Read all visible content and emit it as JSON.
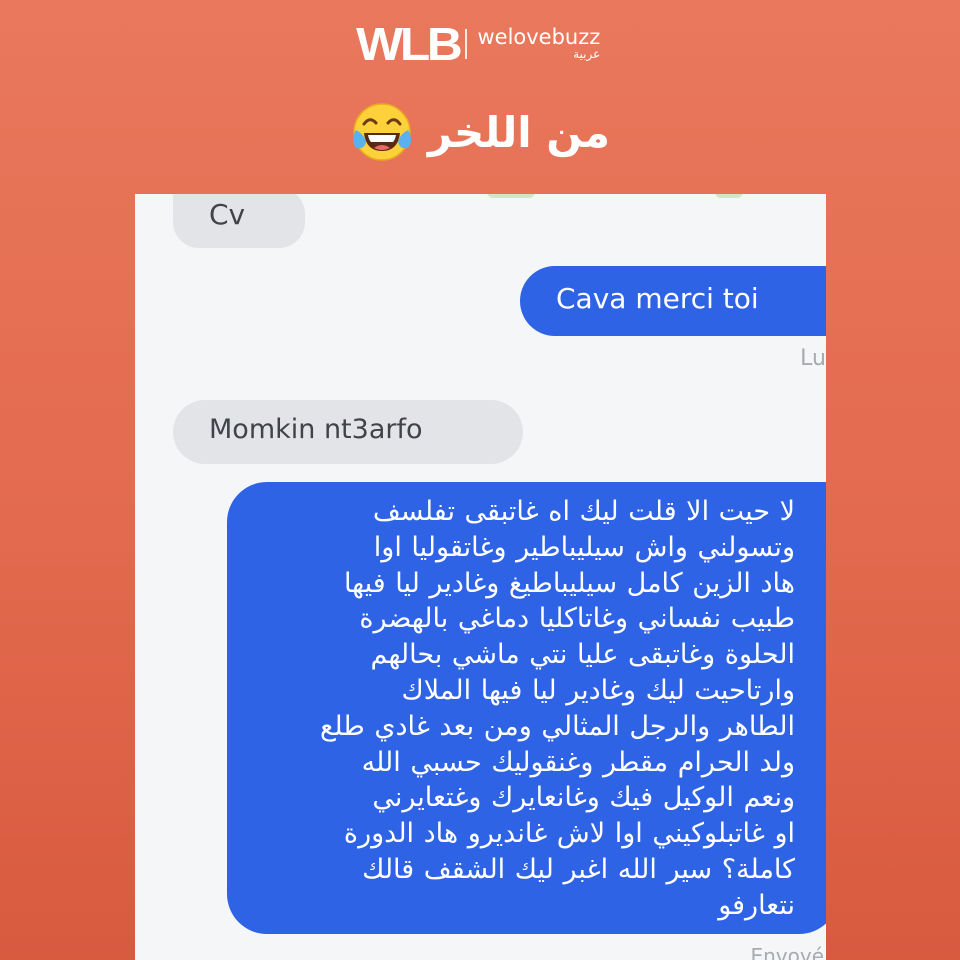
{
  "brand": {
    "logo": "WLB",
    "name": "welovebuzz",
    "sub": "عربية"
  },
  "headline": {
    "text": "من اللخر",
    "icon": "laughing-tears-emoji-icon"
  },
  "chat": {
    "messages": [
      {
        "side": "received",
        "text": "Cv"
      },
      {
        "side": "sent",
        "text": "Cava merci toi"
      },
      {
        "side": "received",
        "text": "Momkin nt3arfo"
      },
      {
        "side": "sent",
        "lines": [
          "لا حيت الا قلت ليك اه غاتبقى تفلسف",
          "وتسولني واش سيليباطير وغاتقوليا اوا",
          "هاد الزين كامل سيليباطيغ وغادير ليا فيها",
          "طبيب نفساني وغاتاكليا دماغي بالهضرة",
          "الحلوة وغاتبقى عليا نتي ماشي بحالهم",
          "وارتاحيت ليك وغادير ليا فيها الملاك",
          "الطاهر والرجل المثالي ومن بعد غادي طلع",
          "ولد الحرام مقطر وغنقوليك حسبي الله",
          "ونعم الوكيل  فيك وغانعايرك وغتعايرني",
          "او غاتبلوكيني اوا لاش غانديرو هاد الدورة",
          "كاملة؟ سير الله اغبر ليك الشقف قالك",
          "نتعارفو"
        ]
      }
    ],
    "timestamp_partial": "Lu",
    "footer_partial": "Envoyé"
  },
  "colors": {
    "background": "#e36a4e",
    "sent_bubble": "#2f63e6",
    "received_bubble": "#e3e4e8"
  }
}
